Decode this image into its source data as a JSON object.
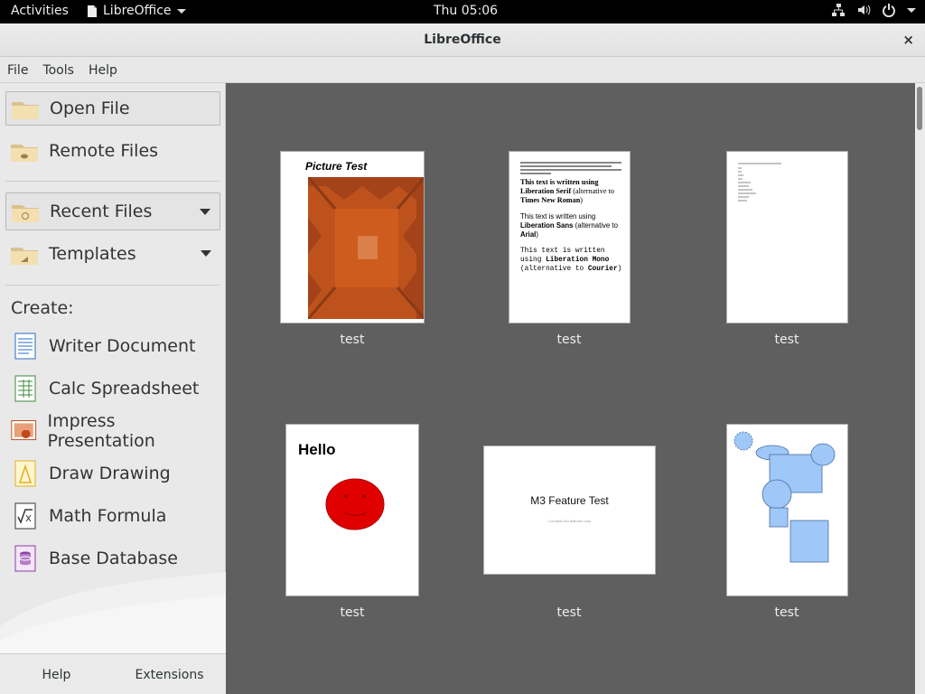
{
  "topbar": {
    "activities": "Activities",
    "app_menu": "LibreOffice",
    "clock": "Thu 05:06"
  },
  "window": {
    "title": "LibreOffice",
    "close": "×"
  },
  "menu": [
    "File",
    "Tools",
    "Help"
  ],
  "sidebar": {
    "open_file": "Open File",
    "remote_files": "Remote Files",
    "recent_files": "Recent Files",
    "templates": "Templates",
    "create_label": "Create:",
    "create_items": [
      {
        "label": "Writer Document",
        "icon": "writer-icon"
      },
      {
        "label": "Calc Spreadsheet",
        "icon": "calc-icon"
      },
      {
        "label": "Impress Presentation",
        "icon": "impress-icon"
      },
      {
        "label": "Draw Drawing",
        "icon": "draw-icon"
      },
      {
        "label": "Math Formula",
        "icon": "math-icon"
      },
      {
        "label": "Base Database",
        "icon": "base-icon"
      }
    ],
    "help": "Help",
    "extensions": "Extensions"
  },
  "recent": [
    {
      "label": "test",
      "preview_title": "Picture Test"
    },
    {
      "label": "test",
      "preview_lines": [
        "This text is written using",
        "Liberation Serif",
        "(alternative",
        "to",
        "Times New Roman",
        ")",
        "This text is written using",
        "Liberation Sans",
        "(alternative to",
        "Arial",
        ")",
        "This text is written",
        "using",
        "Liberation",
        "Mono",
        "(alternative to",
        "Courier",
        ")"
      ]
    },
    {
      "label": "test"
    },
    {
      "label": "test",
      "preview_title": "Hello"
    },
    {
      "label": "test",
      "preview_title": "M3 Feature Test",
      "preview_subtitle": "Contains M3 features only"
    },
    {
      "label": "test"
    }
  ],
  "colors": {
    "accent_writer": "#2a6bc4",
    "accent_calc": "#3c8a3c",
    "accent_impress": "#c0491b",
    "accent_draw": "#e0b020",
    "accent_base": "#8a3f9e"
  }
}
